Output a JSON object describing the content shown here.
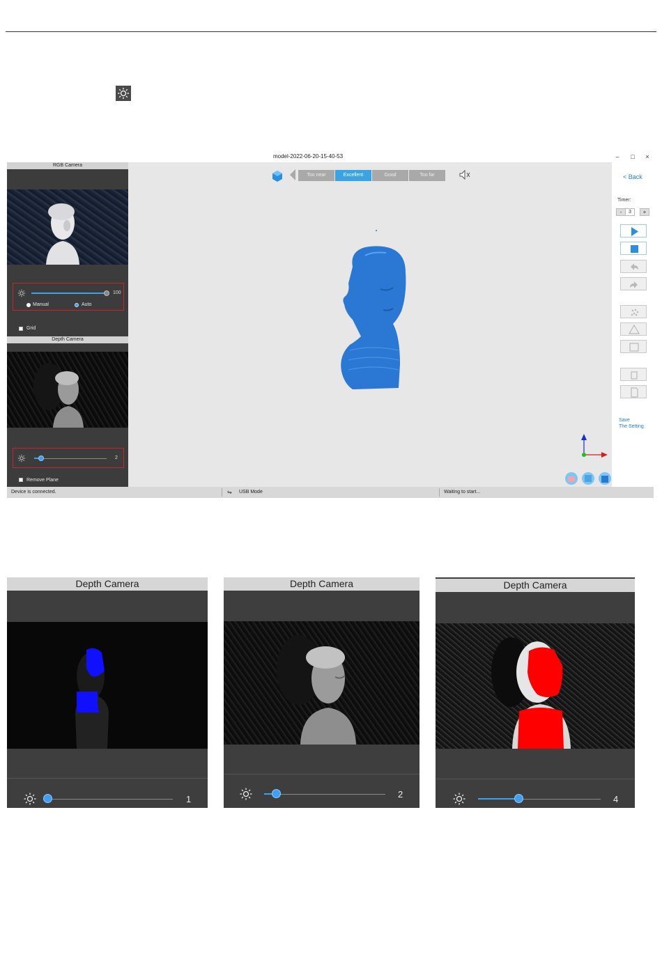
{
  "app": {
    "window_title": "model-2022-06-20-15-40-53",
    "window_controls": [
      "–",
      "□",
      "×"
    ],
    "rgb_panel": {
      "header": "RGB Camera",
      "exposure_value": "100",
      "exposure_fraction": 1.0,
      "mode_manual": "Manual",
      "mode_auto": "Auto",
      "mode_selected": "Auto",
      "grid_label": "Grid"
    },
    "depth_panel": {
      "header": "Depth Camera",
      "exposure_value": "2",
      "exposure_fraction": 0.1,
      "remove_plane_label": "Remove Plane"
    },
    "distance_bar": {
      "segments": [
        "Too near",
        "Excellent",
        "Good",
        "Too far"
      ],
      "active": "Excellent"
    },
    "right_panel": {
      "back_label": "< Back",
      "timer_label": "Timer:",
      "timer_minus": "-",
      "timer_value": "3",
      "timer_plus": "+",
      "save_line1": "Save",
      "save_line2": "The Setting"
    },
    "status_bar": {
      "device": "Device is connected.",
      "mode": "USB Mode",
      "state": "Waiting to start..."
    },
    "colors": {
      "accent": "#3aa3e3",
      "model_blue": "#2a78d4",
      "highlight_box": "#d0202a"
    }
  },
  "depth_examples": [
    {
      "header": "Depth Camera",
      "value": "1",
      "exposure_fraction": 0.0,
      "overlay": "blue"
    },
    {
      "header": "Depth Camera",
      "value": "2",
      "exposure_fraction": 0.1,
      "overlay": "none"
    },
    {
      "header": "Depth Camera",
      "value": "4",
      "exposure_fraction": 0.33,
      "overlay": "red"
    }
  ]
}
